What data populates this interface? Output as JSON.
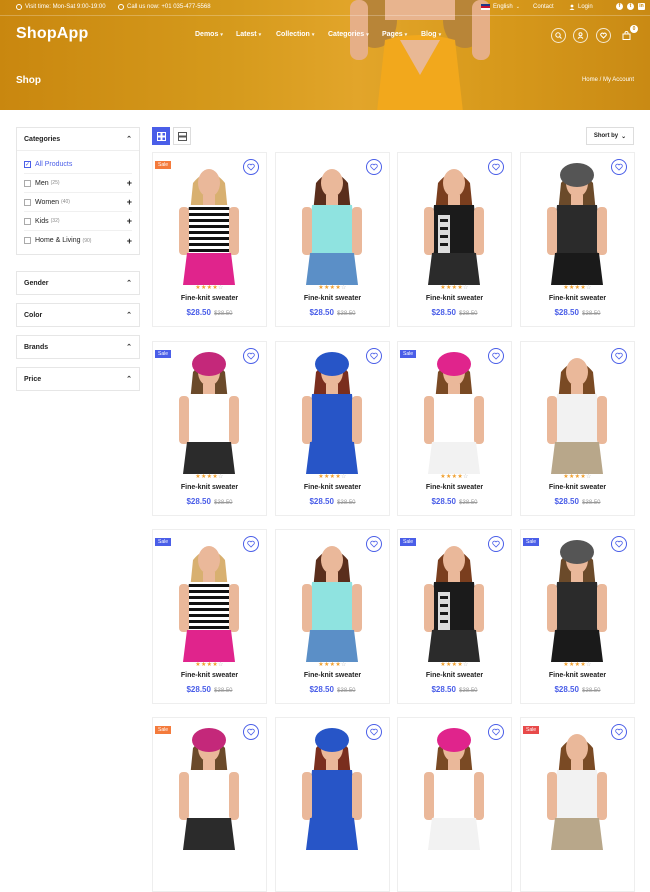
{
  "topbar": {
    "visit_time": "Visit time: Mon-Sat 9:00-19:00",
    "call_us": "Call us now: +01 035-477-5568",
    "language": "English",
    "contact": "Contact",
    "login": "Login",
    "social": [
      "f",
      "t",
      "in"
    ]
  },
  "header": {
    "logo": "ShopApp",
    "nav": [
      "Demos",
      "Latest",
      "Collection",
      "Categories",
      "Pages",
      "Blog"
    ],
    "cart_count": "0"
  },
  "hero": {
    "page_title": "Shop",
    "breadcrumb": "Home  /  My Account"
  },
  "sidebar": {
    "categories_title": "Categories",
    "categories": [
      {
        "label": "All Products",
        "count": "",
        "checked": true
      },
      {
        "label": "Men",
        "count": "(25)",
        "checked": false
      },
      {
        "label": "Women",
        "count": "(40)",
        "checked": false
      },
      {
        "label": "Kids",
        "count": "(32)",
        "checked": false
      },
      {
        "label": "Home & Living",
        "count": "(90)",
        "checked": false
      }
    ],
    "filters": [
      "Gender",
      "Color",
      "Brands",
      "Price"
    ]
  },
  "toolbar": {
    "sort_label": "Short by"
  },
  "products": {
    "name": "Fine-knit sweater",
    "price": "$28.50",
    "old_price": "$38.50",
    "rating": 4,
    "sale_label": "Sale",
    "colors": {
      "accent": "#4a5ee8",
      "sale_orange": "#f47b3c",
      "sale_blue": "#4a5ee8",
      "hero": "#d59a1c"
    }
  }
}
